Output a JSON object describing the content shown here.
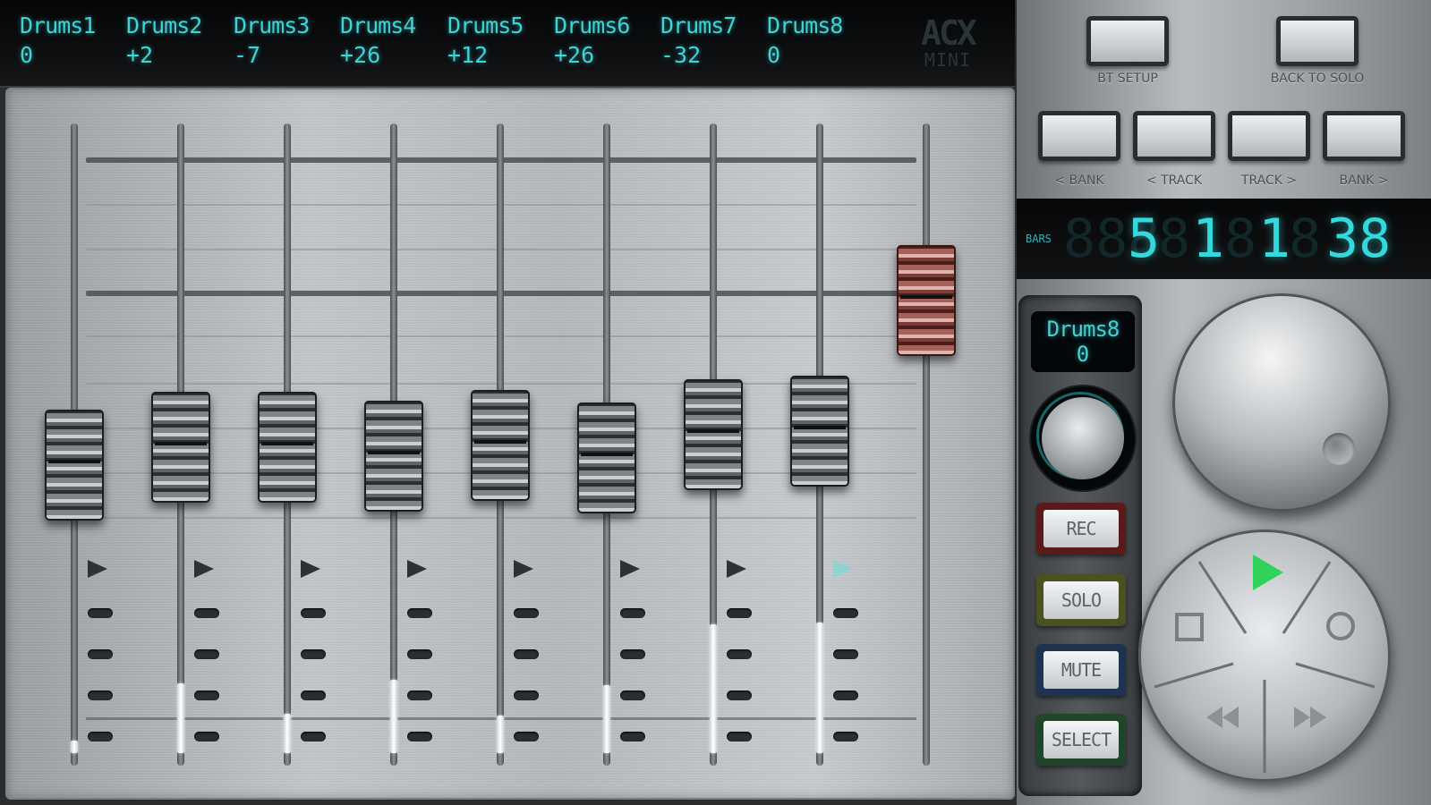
{
  "tracks": [
    {
      "name": "Drums1",
      "value": "0"
    },
    {
      "name": "Drums2",
      "value": "+2"
    },
    {
      "name": "Drums3",
      "value": "-7"
    },
    {
      "name": "Drums4",
      "value": "+26"
    },
    {
      "name": "Drums5",
      "value": "+12"
    },
    {
      "name": "Drums6",
      "value": "+26"
    },
    {
      "name": "Drums7",
      "value": "-32"
    },
    {
      "name": "Drums8",
      "value": "0"
    }
  ],
  "logo": {
    "line1": "ACX",
    "line2": "MINI"
  },
  "buttons": {
    "bt_setup": "BT SETUP",
    "back_to_solo": "BACK TO SOLO",
    "bank_prev": "< BANK",
    "track_prev": "< TRACK",
    "track_next": "TRACK >",
    "bank_next": "BANK >"
  },
  "counter": {
    "label": "BARS",
    "bar": "5",
    "beat": "1",
    "sub": "1",
    "tick": "38"
  },
  "selected_channel": {
    "name": "Drums8",
    "value": "0"
  },
  "channel_buttons": {
    "rec": "REC",
    "solo": "SOLO",
    "mute": "MUTE",
    "select": "SELECT"
  },
  "colors": {
    "lcd": "#3fd3d6",
    "play": "#2fd35a",
    "master_fader": "#a5605a"
  },
  "icons": {
    "play": "play-icon",
    "stop": "stop-icon",
    "record": "record-icon",
    "rewind": "rewind-icon",
    "fast_forward": "fast-forward-icon"
  }
}
